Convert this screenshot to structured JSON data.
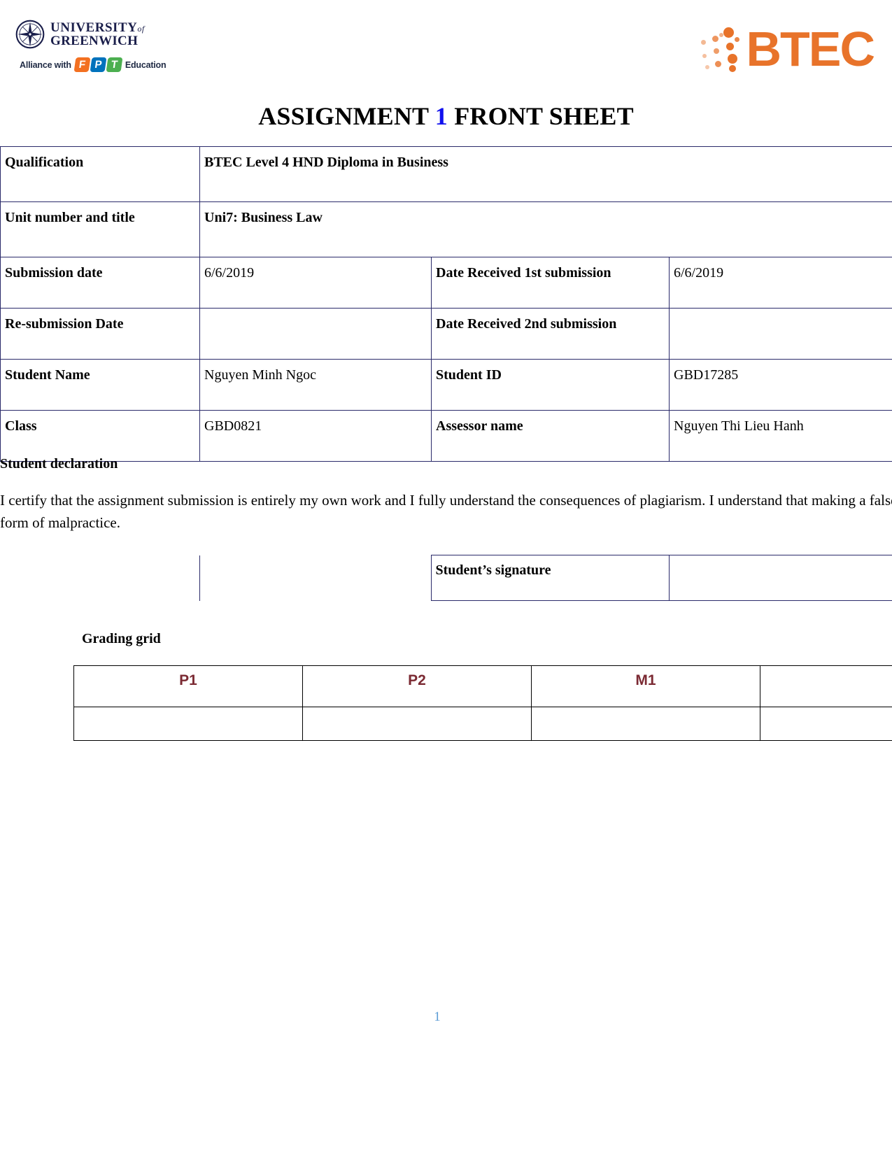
{
  "header": {
    "university_logo": {
      "line1": "UNIVERSITY",
      "line1_suffix": "of",
      "line2": "GREENWICH",
      "icon": "compass-rose-icon"
    },
    "fpt_logo": {
      "prefix": "Alliance with",
      "letters": [
        "F",
        "P",
        "T"
      ],
      "suffix": "Education",
      "colors": [
        "#F37021",
        "#0072BC",
        "#4CAF50"
      ]
    },
    "btec_logo": {
      "text": "BTEC",
      "color": "#E8732A",
      "icon": "btec-dot-cluster-icon"
    }
  },
  "title": {
    "before": "ASSIGNMENT ",
    "number": "1",
    "after": " FRONT SHEET",
    "number_color": "#1111EE"
  },
  "info": {
    "qualification_label": "Qualification",
    "qualification_value": "BTEC Level 4 HND Diploma in Business",
    "unit_label": "Unit number and title",
    "unit_value": "Uni7: Business Law",
    "submission_date_label": "Submission date",
    "submission_date_value": "6/6/2019",
    "date_received_1st_label": "Date Received 1st submission",
    "date_received_1st_value": "6/6/2019",
    "resubmission_date_label": "Re-submission Date",
    "resubmission_date_value": "",
    "date_received_2nd_label": "Date Received 2nd submission",
    "date_received_2nd_value": "",
    "student_name_label": "Student Name",
    "student_name_value": "Nguyen Minh Ngoc",
    "student_id_label": "Student ID",
    "student_id_value": "GBD17285",
    "class_label": "Class",
    "class_value": "GBD0821",
    "assessor_name_label": "Assessor name",
    "assessor_name_value": "Nguyen Thi Lieu Hanh"
  },
  "declaration": {
    "heading": "Student declaration",
    "text": "I certify that the assignment submission is entirely my own work and I fully understand the consequences of plagiarism. I understand that making a false declaration is a form of malpractice.",
    "signature_label": "Student’s signature",
    "signature_value": ""
  },
  "grading_grid": {
    "heading": "Grading grid",
    "columns": [
      "P1",
      "P2",
      "M1",
      ""
    ],
    "values": [
      "",
      "",
      "",
      ""
    ],
    "header_color": "#7B2A33"
  },
  "footer": {
    "page_number": "1",
    "page_number_color": "#5B9BD5"
  }
}
